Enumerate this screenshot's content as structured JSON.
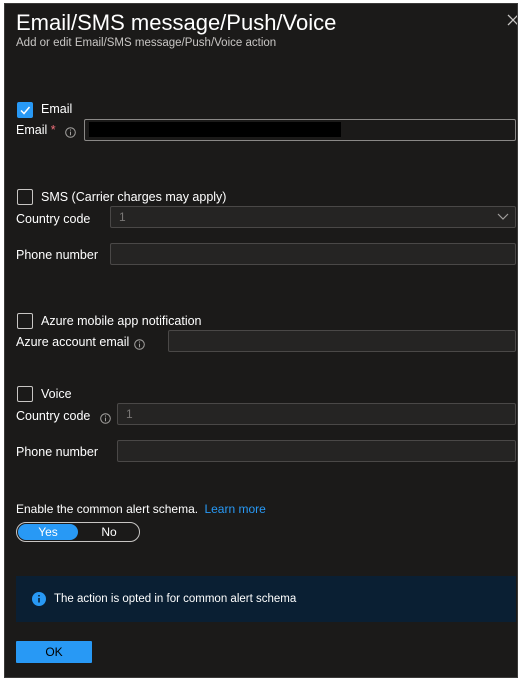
{
  "header": {
    "title": "Email/SMS message/Push/Voice",
    "subtitle": "Add or edit Email/SMS message/Push/Voice action"
  },
  "email": {
    "checkbox_label": "Email",
    "checked": true,
    "field_label": "Email",
    "required_mark": "*",
    "value_redacted": true
  },
  "sms": {
    "checkbox_label": "SMS (Carrier charges may apply)",
    "checked": false,
    "country_label": "Country code",
    "country_value": "1",
    "phone_label": "Phone number",
    "phone_value": ""
  },
  "push": {
    "checkbox_label": "Azure mobile app notification",
    "checked": false,
    "account_label": "Azure account email",
    "account_value": ""
  },
  "voice": {
    "checkbox_label": "Voice",
    "checked": false,
    "country_label": "Country code",
    "country_value": "1",
    "phone_label": "Phone number",
    "phone_value": ""
  },
  "schema": {
    "label": "Enable the common alert schema.",
    "link": "Learn more",
    "yes": "Yes",
    "no": "No",
    "selected": "Yes"
  },
  "banner": {
    "text": "The action is opted in for common alert schema"
  },
  "footer": {
    "ok_label": "OK"
  },
  "colors": {
    "panel_bg": "#1b1a19",
    "accent": "#2899f5",
    "banner_bg": "#0a1f33"
  }
}
